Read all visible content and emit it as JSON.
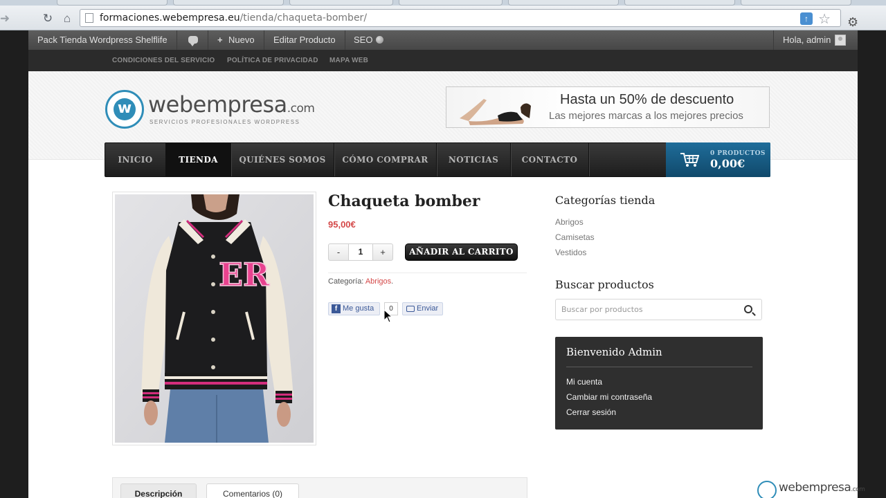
{
  "browser": {
    "url_host": "formaciones.webempresa.eu",
    "url_path": "/tienda/chaqueta-bomber/"
  },
  "admin_bar": {
    "site_name": "Pack Tienda Wordpress Shelflife",
    "new_label": "Nuevo",
    "edit_label": "Editar Producto",
    "seo_label": "SEO",
    "greeting": "Hola, admin"
  },
  "top_links": [
    "CONDICIONES DEL SERVICIO",
    "POLÍTICA DE PRIVACIDAD",
    "MAPA WEB"
  ],
  "logo": {
    "wordmark": "webempresa",
    "tld": ".com",
    "tagline": "SERVICIOS PROFESIONALES WORDPRESS"
  },
  "banner": {
    "headline": "Hasta un 50% de descuento",
    "subline": "Las mejores marcas a los mejores precios"
  },
  "nav": [
    "INICIO",
    "TIENDA",
    "QUIÉNES SOMOS",
    "CÓMO COMPRAR",
    "NOTICIAS",
    "CONTACTO"
  ],
  "nav_active": "TIENDA",
  "cart": {
    "count_label": "0 PRODUCTOS",
    "total": "0,00€"
  },
  "product": {
    "title": "Chaqueta bomber",
    "price": "95,00€",
    "qty_minus": "-",
    "qty_value": "1",
    "qty_plus": "+",
    "add_to_cart": "AÑADIR AL CARRITO",
    "category_label": "Categoría:",
    "category_link": "Abrigos",
    "category_suffix": ".",
    "jacket_letters": "ER"
  },
  "social": {
    "like_label": "Me gusta",
    "like_count": "0",
    "send_label": "Enviar"
  },
  "sidebar": {
    "categories_heading": "Categorías tienda",
    "categories": [
      "Abrigos",
      "Camisetas",
      "Vestidos"
    ],
    "search_heading": "Buscar productos",
    "search_placeholder": "Buscar por productos",
    "welcome_title": "Bienvenido Admin",
    "account_links": [
      "Mi cuenta",
      "Cambiar mi contraseña",
      "Cerrar sesión"
    ]
  },
  "tabs": [
    "Descripción",
    "Comentarios (0)"
  ],
  "watermark": {
    "wordmark": "webempresa",
    "tld": ".com"
  },
  "colors": {
    "accent_price": "#d44848",
    "cart_blue": "#1f6d9a",
    "brand_blue": "#2f8db8"
  }
}
